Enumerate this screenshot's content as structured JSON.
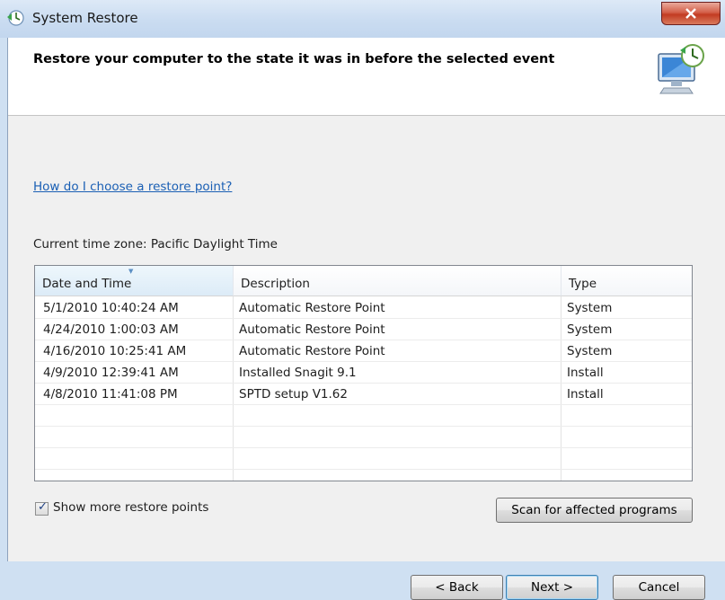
{
  "window": {
    "title": "System Restore",
    "close_label": "✕"
  },
  "header": {
    "heading": "Restore your computer to the state it was in before the selected event"
  },
  "help_link": "How do I choose a restore point?",
  "timezone_text": "Current time zone: Pacific Daylight Time",
  "table": {
    "columns": [
      "Date and Time",
      "Description",
      "Type"
    ],
    "rows": [
      {
        "date": "5/1/2010 10:40:24 AM",
        "description": "Automatic Restore Point",
        "type": "System"
      },
      {
        "date": "4/24/2010 1:00:03 AM",
        "description": "Automatic Restore Point",
        "type": "System"
      },
      {
        "date": "4/16/2010 10:25:41 AM",
        "description": "Automatic Restore Point",
        "type": "System"
      },
      {
        "date": "4/9/2010 12:39:41 AM",
        "description": "Installed Snagit 9.1",
        "type": "Install"
      },
      {
        "date": "4/8/2010 11:41:08 PM",
        "description": "SPTD setup V1.62",
        "type": "Install"
      }
    ]
  },
  "show_more": {
    "label": "Show more restore points",
    "checked": true
  },
  "buttons": {
    "scan": "Scan for affected programs",
    "back": "< Back",
    "next": "Next >",
    "cancel": "Cancel"
  },
  "icons": {
    "title_icon": "system-restore-icon",
    "header_icon": "restore-computer-clock-icon"
  },
  "colors": {
    "link": "#1a5fb4",
    "close_button": "#c23b22",
    "title_bar": "#cadcf1"
  }
}
